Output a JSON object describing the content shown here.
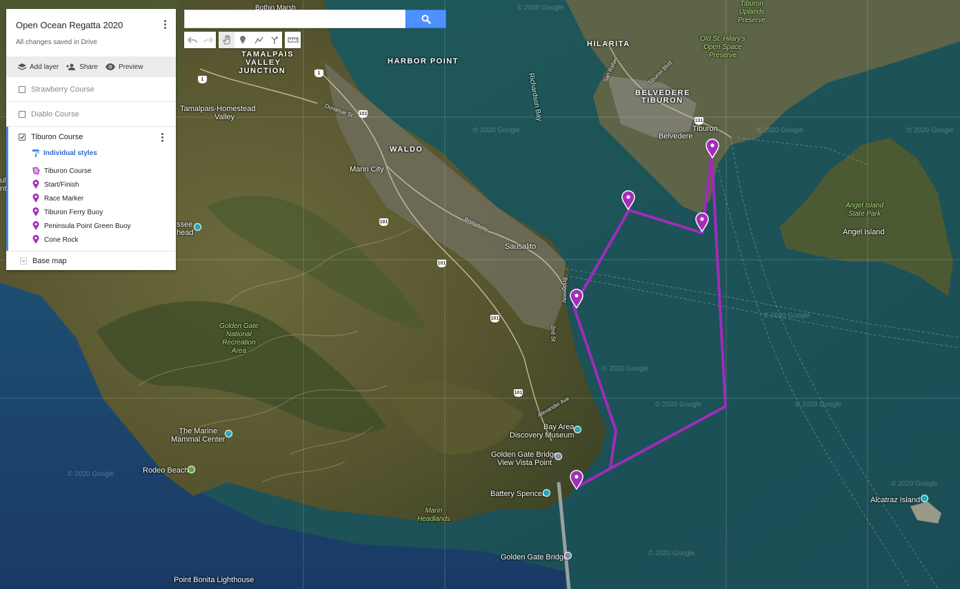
{
  "map": {
    "labels": {
      "botany_marsh": "Bothin Marsh",
      "tamalpais_valley": "TAMALPAIS",
      "tamalpais_valley2": "VALLEY",
      "tamalpais_valley3": "JUNCTION",
      "harbor_point": "HARBOR POINT",
      "hilarita": "HILARITA",
      "belvedere_tiburon": "BELVEDERE",
      "belvedere_tiburon2": "TIBURON",
      "belvedere": "Belvedere",
      "tiburon": "Tiburon",
      "richardson_bay": "Richardson Bay",
      "tamalpais_homestead": "Tamalpais-Homestead",
      "tamalpais_homestead2": "Valley",
      "waldo": "WALDO",
      "marin_city": "Marin City",
      "sausalito": "Sausalito",
      "bridgeway": "Bridgeway",
      "bridgeway2": "Bridgeway",
      "donahue": "Donahue St",
      "tiburon_blvd": "Tiburon Blvd",
      "san_rafael": "San Rafael",
      "alexander": "Alexander Ave",
      "second_st": "2nd St",
      "ggnra": "Golden Gate\nNational\nRecreation\nArea",
      "marine_mammal": "The Marine\nMammal Center",
      "rodeo_beach": "Rodeo Beach",
      "bay_area_museum": "Bay Area\nDiscovery Museum",
      "gg_vista": "Golden Gate Bridge\nView Vista Point",
      "battery_spencer": "Battery Spencer",
      "marin_headlands": "Marin\nHeadlands",
      "golden_gate_bridge": "Golden Gate Bridge",
      "point_bonita": "Point Bonita Lighthouse",
      "angel_island": "Angel Island",
      "angel_island_sp": "Angel Island\nState Park",
      "alcatraz": "Alcatraz Island",
      "tiburon_uplands": "Tiburon\nUplands\nPreserve",
      "old_st_hilarys": "Old St. Hilary's\nOpen Space\nPreserve",
      "ssee_head": "ssee\nhead",
      "ulent": "ul\nnt"
    },
    "shields": [
      "1",
      "1",
      "101",
      "101",
      "101",
      "101",
      "101",
      "131"
    ],
    "watermark": "© 2020 Google",
    "route_color": "#9c27b0",
    "marker_color": "#a52dbb"
  },
  "search": {
    "placeholder": "",
    "value": "",
    "icon": "search-icon"
  },
  "toolbar": {
    "tools": [
      "undo-icon",
      "redo-icon",
      "hand-icon",
      "marker-icon",
      "draw-line-icon",
      "directions-icon",
      "ruler-icon"
    ]
  },
  "panel": {
    "title": "Open Ocean Regatta 2020",
    "status": "All changes saved in Drive",
    "actions": {
      "add_layer": "Add layer",
      "share": "Share",
      "preview": "Preview"
    },
    "layers": {
      "strawberry": {
        "name": "Strawberry Course",
        "checked": false
      },
      "diablo": {
        "name": "Diablo Course",
        "checked": false
      },
      "tiburon": {
        "name": "Tiburon Course",
        "checked": true,
        "styles_label": "Individual styles",
        "features": [
          {
            "name": "Tiburon Course",
            "icon": "polygon-icon"
          },
          {
            "name": "Start/Finish",
            "icon": "pin-icon"
          },
          {
            "name": "Race Marker",
            "icon": "pin-icon"
          },
          {
            "name": "Tiburon Ferry Buoy",
            "icon": "pin-icon"
          },
          {
            "name": "Peninsula Point Green Buoy",
            "icon": "pin-icon"
          },
          {
            "name": "Cone Rock",
            "icon": "pin-icon"
          }
        ]
      }
    },
    "base_map": "Base map"
  }
}
